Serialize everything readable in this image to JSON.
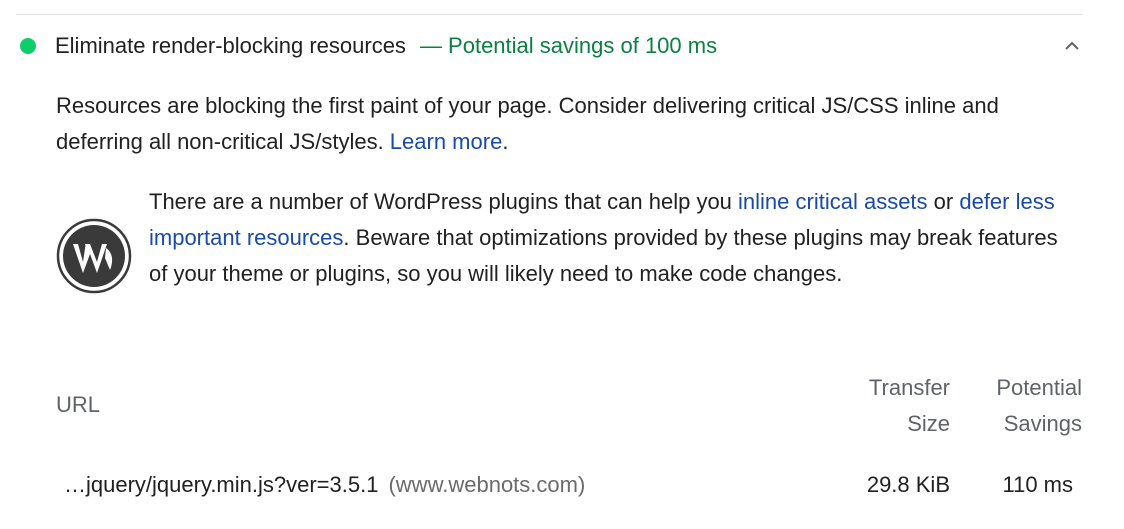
{
  "audit": {
    "title": "Eliminate render-blocking resources",
    "savings": "— Potential savings of 100 ms",
    "status_color": "#0cce6b",
    "savings_color": "#0b8043",
    "expanded_icon": "chevron-up-icon",
    "description_text": "Resources are blocking the first paint of your page. Consider delivering critical JS/CSS inline and deferring all non-critical JS/styles. ",
    "learn_more": "Learn more",
    "description_end": "."
  },
  "stack_pack": {
    "logo_icon": "wordpress-logo-icon",
    "text_1": "There are a number of WordPress plugins that can help you ",
    "link_1": "inline critical assets",
    "text_2": " or ",
    "link_2": "defer less important resources",
    "text_3": ". Beware that optimizations provided by these plugins may break features of your theme or plugins, so you will likely need to make code changes."
  },
  "table": {
    "headers": {
      "url": "URL",
      "transfer_size_1": "Transfer",
      "transfer_size_2": "Size",
      "potential_savings_1": "Potential",
      "potential_savings_2": "Savings"
    },
    "rows": [
      {
        "url": "…jquery/jquery.min.js?ver=3.5.1",
        "host": "(www.webnots.com)",
        "transfer_size": "29.8 KiB",
        "savings": "110 ms"
      }
    ]
  },
  "colors": {
    "link": "#1a4aa8",
    "header_text": "#5f6368"
  }
}
